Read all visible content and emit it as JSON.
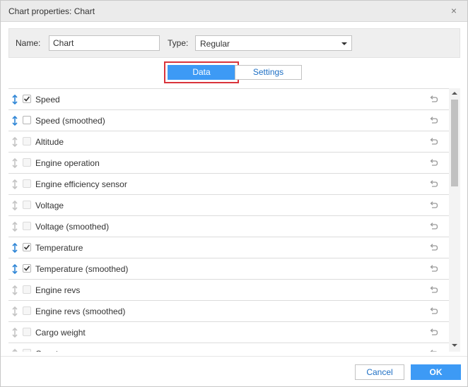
{
  "dialog": {
    "title": "Chart properties: Chart",
    "close_icon": "close-icon"
  },
  "props": {
    "name_label": "Name:",
    "name_value": "Chart",
    "type_label": "Type:",
    "type_value": "Regular"
  },
  "tabs": {
    "data_label": "Data",
    "settings_label": "Settings",
    "active": "Data",
    "highlight_color": "#d9343b"
  },
  "colors": {
    "accent": "#3d9af5",
    "link": "#1e6fc4",
    "drag_active": "#2f86d6",
    "drag_inactive": "#c4c4c4"
  },
  "rows": [
    {
      "label": "Speed",
      "checked": true,
      "active": true
    },
    {
      "label": "Speed (smoothed)",
      "checked": false,
      "active": true
    },
    {
      "label": "Altitude",
      "checked": false,
      "active": false
    },
    {
      "label": "Engine operation",
      "checked": false,
      "active": false
    },
    {
      "label": "Engine efficiency sensor",
      "checked": false,
      "active": false
    },
    {
      "label": "Voltage",
      "checked": false,
      "active": false
    },
    {
      "label": "Voltage (smoothed)",
      "checked": false,
      "active": false
    },
    {
      "label": "Temperature",
      "checked": true,
      "active": true
    },
    {
      "label": "Temperature (smoothed)",
      "checked": true,
      "active": true
    },
    {
      "label": "Engine revs",
      "checked": false,
      "active": false
    },
    {
      "label": "Engine revs (smoothed)",
      "checked": false,
      "active": false
    },
    {
      "label": "Cargo weight",
      "checked": false,
      "active": false
    },
    {
      "label": "Counter sensors",
      "checked": false,
      "active": false
    }
  ],
  "footer": {
    "cancel_label": "Cancel",
    "ok_label": "OK"
  }
}
